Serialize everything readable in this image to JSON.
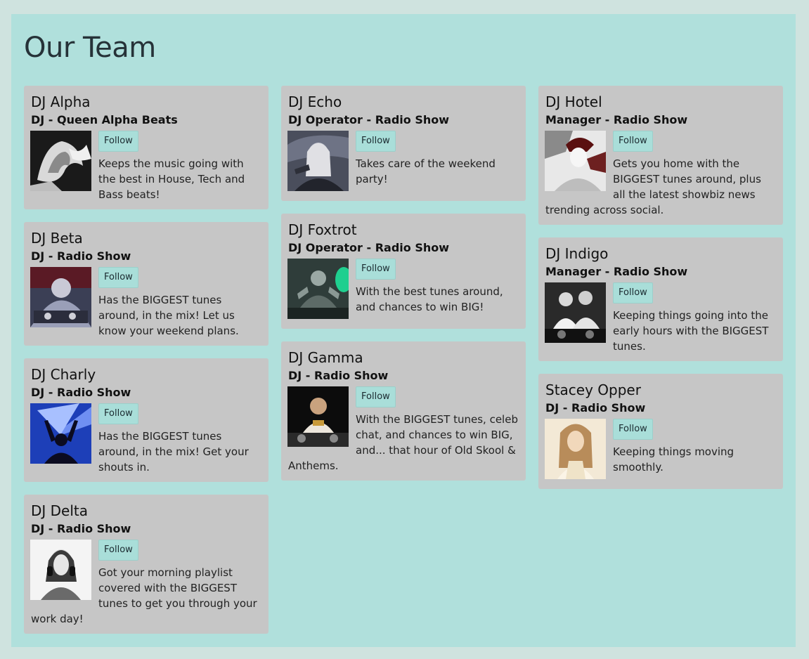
{
  "page": {
    "title": "Our Team",
    "follow_label": "Follow"
  },
  "colors": {
    "background": "#cfe3df",
    "panel": "#b0e0dc",
    "card": "#c6c6c6",
    "button": "#a9ded9"
  },
  "columns": [
    [
      {
        "name": "DJ Alpha",
        "role": "DJ - Queen Alpha Beats",
        "bio": "Keeps the music going with the best in House, Tech and Bass beats!",
        "image_icon": "dj-photo"
      },
      {
        "name": "DJ Beta",
        "role": "DJ - Radio Show",
        "bio": "Has the BIGGEST tunes around, in the mix! Let us know your weekend plans.",
        "image_icon": "dj-photo"
      },
      {
        "name": "DJ Charly",
        "role": "DJ - Radio Show",
        "bio": "Has the BIGGEST tunes around, in the mix! Get your shouts in.",
        "image_icon": "dj-photo"
      },
      {
        "name": "DJ Delta",
        "role": "DJ - Radio Show",
        "bio": "Got your morning playlist covered with the BIGGEST tunes to get you through your work day!",
        "image_icon": "dj-photo"
      }
    ],
    [
      {
        "name": "DJ Echo",
        "role": "DJ Operator - Radio Show",
        "bio": "Takes care of the weekend party!",
        "image_icon": "dj-photo"
      },
      {
        "name": "DJ Foxtrot",
        "role": "DJ Operator - Radio Show",
        "bio": "With the best tunes around, and chances to win BIG!",
        "image_icon": "dj-photo"
      },
      {
        "name": "DJ Gamma",
        "role": "DJ - Radio Show",
        "bio": "With the BIGGEST tunes, celeb chat, and chances to win BIG, and... that hour of Old Skool & Anthems.",
        "image_icon": "dj-photo"
      }
    ],
    [
      {
        "name": "DJ Hotel",
        "role": "Manager - Radio Show",
        "bio": "Gets you home with the BIGGEST tunes around, plus all the latest showbiz news trending across social.",
        "image_icon": "dj-photo"
      },
      {
        "name": "DJ Indigo",
        "role": "Manager - Radio Show",
        "bio": "Keeping things going into the early hours with the BIGGEST tunes.",
        "image_icon": "dj-photo"
      },
      {
        "name": "Stacey Opper",
        "role": "DJ - Radio Show",
        "bio": "Keeping things moving smoothly.",
        "image_icon": "dj-photo"
      }
    ]
  ]
}
